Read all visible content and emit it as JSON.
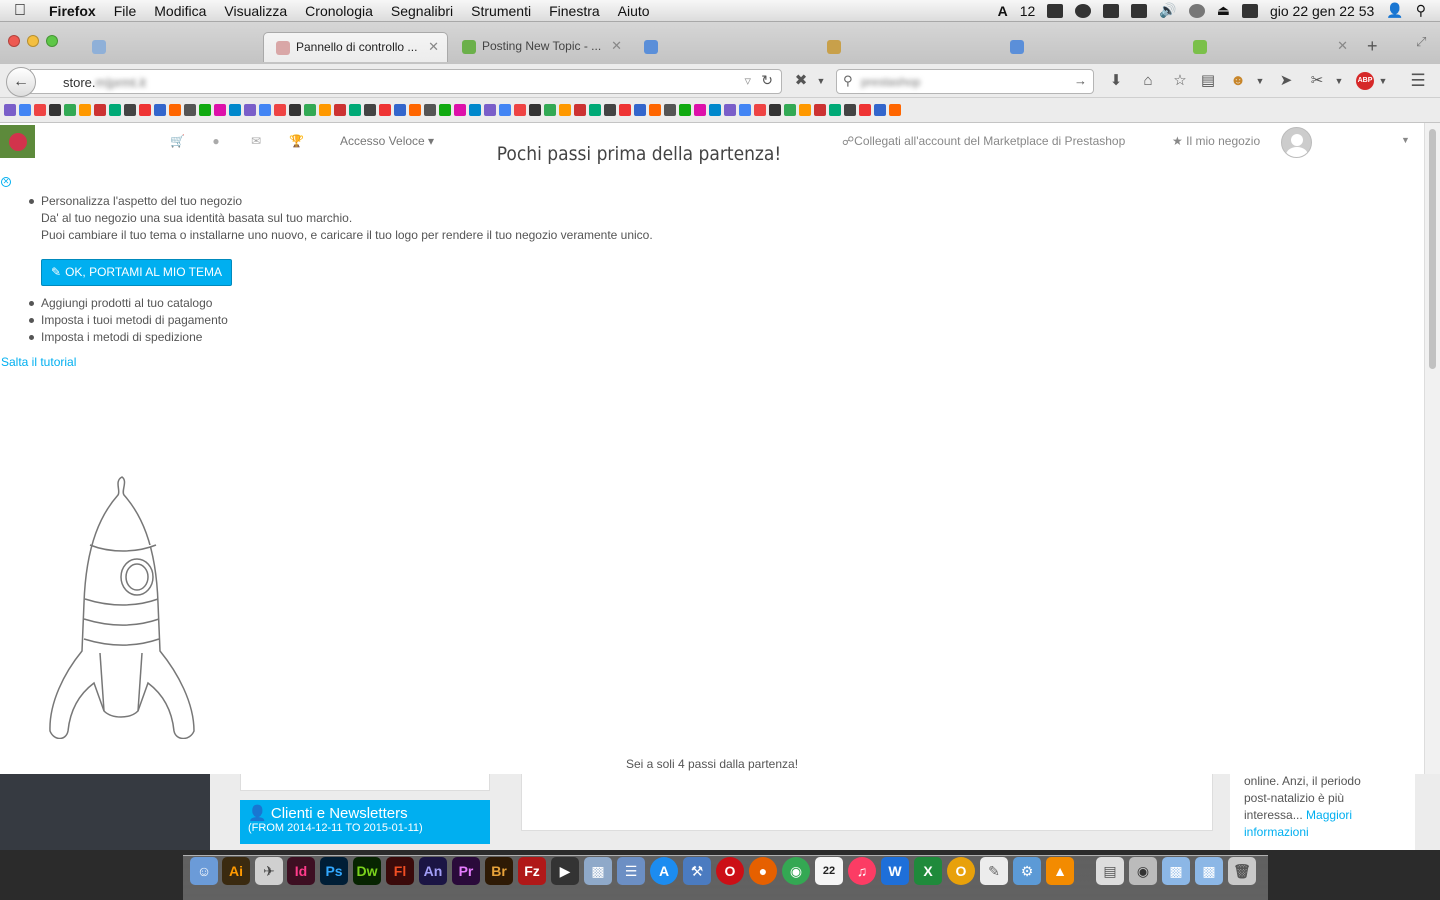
{
  "menubar": {
    "app_name": "Firefox",
    "items": [
      "File",
      "Modifica",
      "Visualizza",
      "Cronologia",
      "Segnalibri",
      "Strumenti",
      "Finestra",
      "Aiuto"
    ],
    "badge_count": "12",
    "clock": "gio 22 gen  22 53"
  },
  "tabs": [
    {
      "label": "Pannello di controllo ...",
      "active": true
    },
    {
      "label": "Posting New Topic - ...",
      "active": false
    }
  ],
  "urlbar": {
    "prefix": "store.",
    "host_blurred": "m|prmt.it"
  },
  "bookmarks_count": 60,
  "admin_header": {
    "quick_access": "Accesso Veloce",
    "marketplace_link": "Collegati all'account del Marketplace di Prestashop",
    "my_store": "Il mio negozio"
  },
  "onboarding": {
    "title": "Pochi passi prima della partenza!",
    "step1_title": "Personalizza l'aspetto del tuo negozio",
    "step1_line1": "Da' al tuo negozio una sua identità basata sul tuo marchio.",
    "step1_line2": "Puoi cambiare il tuo tema o installarne uno nuovo, e caricare il tuo logo per rendere il tuo negozio veramente unico.",
    "cta_label": "OK, PORTAMI AL MIO TEMA",
    "step2": "Aggiungi prodotti al tuo catalogo",
    "step3": "Imposta i tuoi metodi di pagamento",
    "step4": "Imposta i metodi di spedizione",
    "skip_link": "Salta il tutorial",
    "footer": "Sei a soli 4 passi dalla partenza!"
  },
  "background_page": {
    "clients_card_title": "Clienti e Newsletters",
    "clients_card_range": "(FROM 2014-12-11 TO 2015-01-11)",
    "news_text_1": "online. Anzi, il periodo",
    "news_text_2": "post-natalizio è più",
    "news_text_3": "interessa...",
    "news_link": "Maggiori informazioni"
  },
  "colors": {
    "accent": "#00aff0",
    "sidebar": "#363a41",
    "logo_green": "#5d8a3b"
  }
}
